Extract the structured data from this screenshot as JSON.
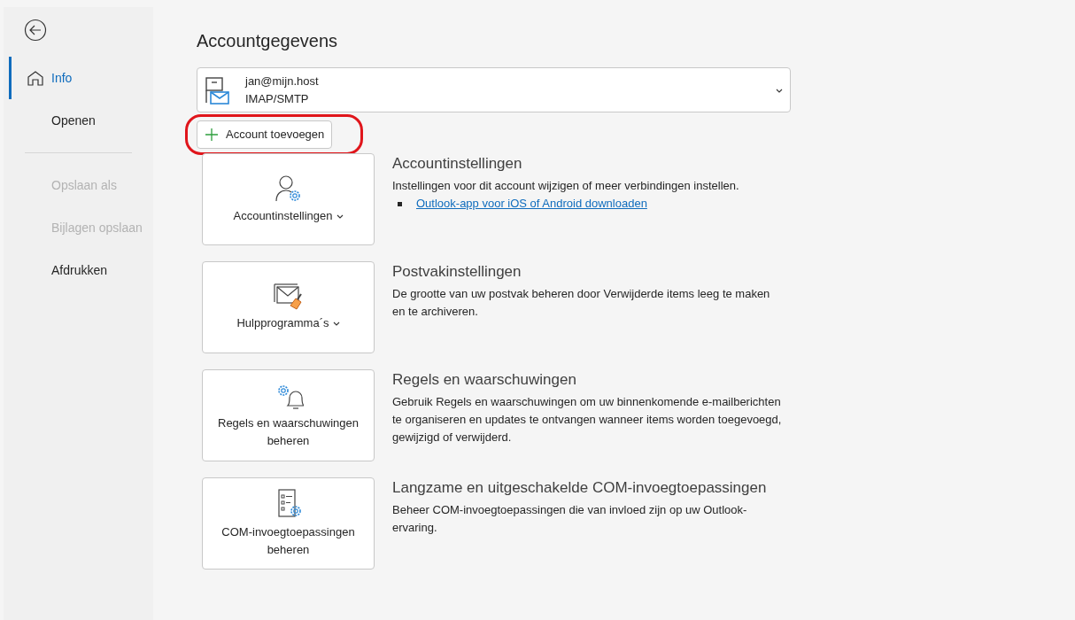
{
  "sidebar": {
    "items": [
      {
        "label": "Info",
        "selected": true,
        "disabled": false,
        "kind": "home"
      },
      {
        "label": "Openen",
        "selected": false,
        "disabled": false,
        "kind": "plain"
      },
      {
        "kind": "divider"
      },
      {
        "label": "Opslaan als",
        "selected": false,
        "disabled": true,
        "kind": "plain"
      },
      {
        "label": "Bijlagen opslaan",
        "selected": false,
        "disabled": true,
        "kind": "plain"
      },
      {
        "label": "Afdrukken",
        "selected": false,
        "disabled": false,
        "kind": "plain"
      }
    ]
  },
  "page_title": "Accountgegevens",
  "account": {
    "email": "jan@mijn.host",
    "type": "IMAP/SMTP"
  },
  "add_account": {
    "label": "Account toevoegen",
    "highlighted": true
  },
  "sections": [
    {
      "kind": "account",
      "button": "Accountinstellingen",
      "dropdown": true,
      "title": "Accountinstellingen",
      "description": "Instellingen voor dit account wijzigen of meer verbindingen instellen.",
      "link": "Outlook-app voor iOS of Android downloaden"
    },
    {
      "kind": "mailbox",
      "button": "Hulpprogramma´s",
      "dropdown": true,
      "title": "Postvakinstellingen",
      "description": "De grootte van uw postvak beheren door Verwijderde items leeg te maken en te archiveren."
    },
    {
      "kind": "rules",
      "button": "Regels en waarschuwingen beheren",
      "dropdown": false,
      "title": "Regels en waarschuwingen",
      "description": "Gebruik Regels en waarschuwingen om uw binnenkomende e-mailberichten te organiseren en updates te ontvangen wanneer items worden toegevoegd, gewijzigd of verwijderd."
    },
    {
      "kind": "addins",
      "button": "COM-invoegtoepassingen beheren",
      "dropdown": false,
      "title": "Langzame en uitgeschakelde COM-invoegtoepassingen",
      "description": "Beheer COM-invoegtoepassingen die van invloed zijn op uw Outlook-ervaring."
    }
  ]
}
